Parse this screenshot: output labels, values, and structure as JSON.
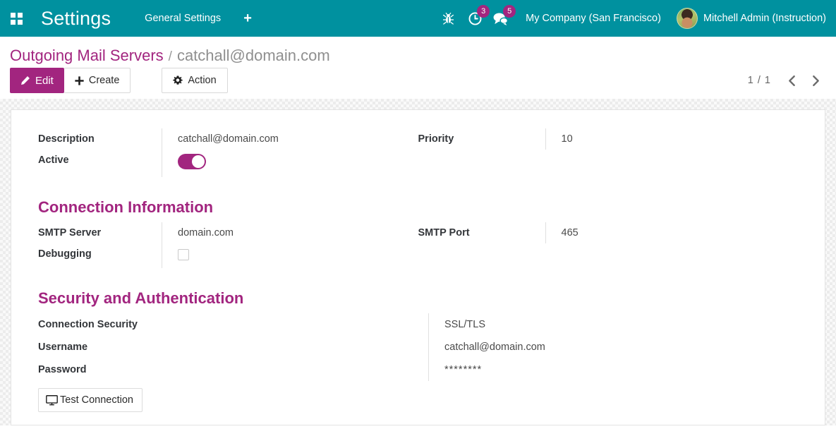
{
  "navbar": {
    "apps_icon": "apps-grid-icon",
    "brand": "Settings",
    "menu": [
      {
        "label": "General Settings"
      }
    ],
    "plus_label": "+",
    "bug_icon": "bug-icon",
    "activities": {
      "icon": "clock-icon",
      "count": "3"
    },
    "messages": {
      "icon": "chat-bubble-icon",
      "count": "5"
    },
    "company": "My Company (San Francisco)",
    "user": "Mitchell Admin (Instruction)",
    "accent_color": "#00919f"
  },
  "breadcrumb": {
    "parent": "Outgoing Mail Servers",
    "separator": "/",
    "current": "catchall@domain.com"
  },
  "toolbar": {
    "edit_label": "Edit",
    "create_label": "Create",
    "action_label": "Action",
    "edit_color": "#a2257f"
  },
  "pager": {
    "value": "1 / 1",
    "prev_icon": "chevron-left-icon",
    "next_icon": "chevron-right-icon"
  },
  "form": {
    "description": {
      "label": "Description",
      "value": "catchall@domain.com"
    },
    "active": {
      "label": "Active",
      "state": "on"
    },
    "priority": {
      "label": "Priority",
      "value": "10"
    },
    "connection_section": {
      "title": "Connection Information",
      "smtp_server": {
        "label": "SMTP Server",
        "value": "domain.com"
      },
      "debugging": {
        "label": "Debugging",
        "state": "off"
      },
      "smtp_port": {
        "label": "SMTP Port",
        "value": "465"
      }
    },
    "security_section": {
      "title": "Security and Authentication",
      "connection_security": {
        "label": "Connection Security",
        "value": "SSL/TLS"
      },
      "username": {
        "label": "Username",
        "value": "catchall@domain.com"
      },
      "password": {
        "label": "Password",
        "value": "********"
      },
      "test_connection": {
        "label": "Test Connection",
        "icon": "monitor-icon"
      }
    }
  }
}
